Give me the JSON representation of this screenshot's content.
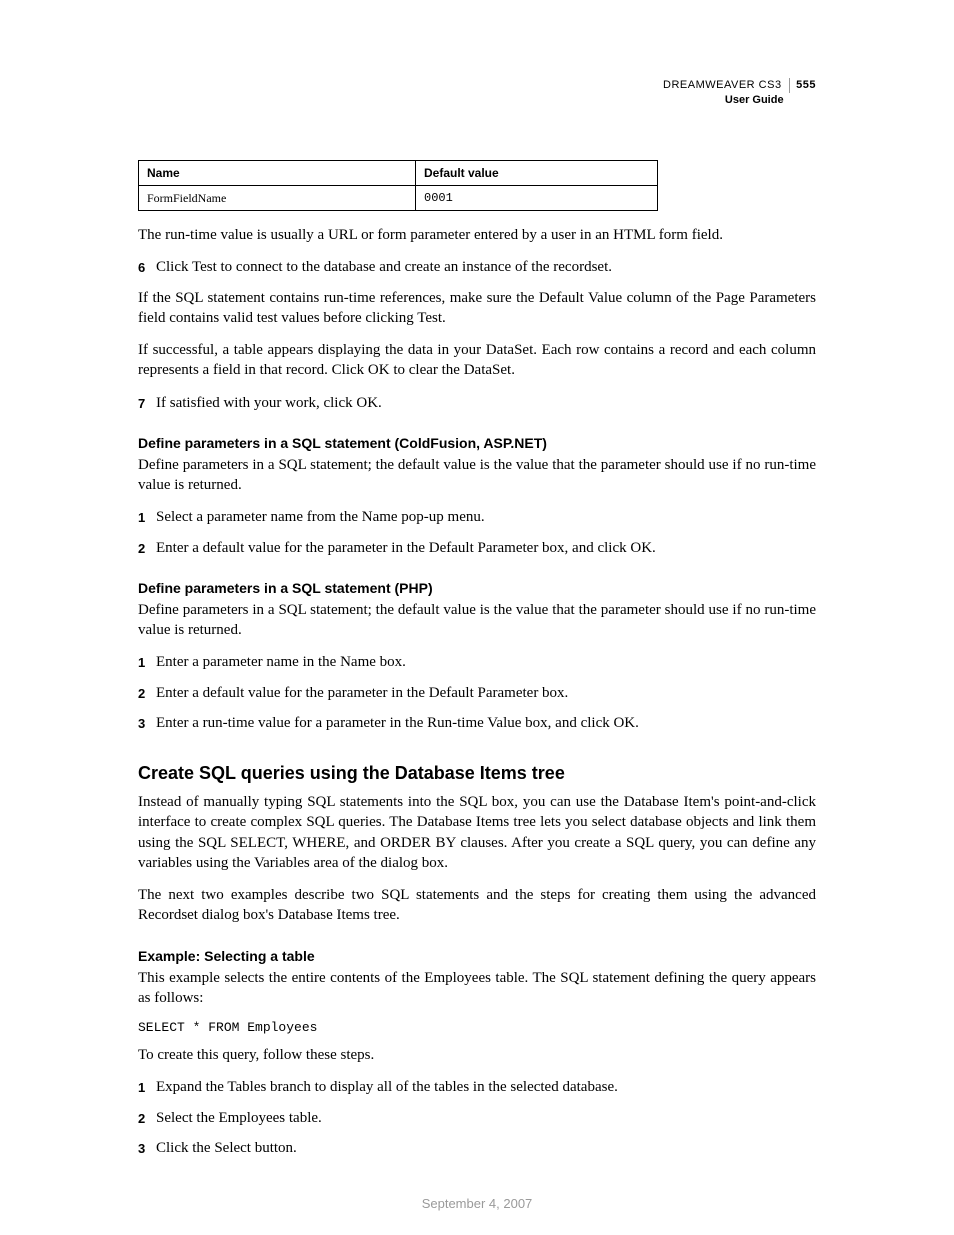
{
  "header": {
    "product": "DREAMWEAVER CS3",
    "guide": "User Guide",
    "page_number": "555"
  },
  "table": {
    "col1": "Name",
    "col2": "Default value",
    "row1_name": "FormFieldName",
    "row1_value": "0001"
  },
  "para": {
    "p1": "The run-time value is usually a URL or form parameter entered by a user in an HTML form field.",
    "p2": "If the SQL statement contains run-time references, make sure the Default Value column of the Page Parameters field contains valid test values before clicking Test.",
    "p3": "If successful, a table appears displaying the data in your DataSet. Each row contains a record and each column represents a field in that record. Click OK to clear the DataSet.",
    "cf_intro": "Define parameters in a SQL statement; the default value is the value that the parameter should use if no run-time value is returned.",
    "php_intro": "Define parameters in a SQL statement; the default value is the value that the parameter should use if no run-time value is returned.",
    "sql_p1": "Instead of manually typing SQL statements into the SQL box, you can use the Database Item's point-and-click interface to create complex SQL queries. The Database Items tree lets you select database objects and link them using the SQL SELECT, WHERE, and ORDER BY clauses. After you create a SQL query, you can define any variables using the Variables area of the dialog box.",
    "sql_p2": "The next two examples describe two SQL statements and the steps for creating them using the advanced Recordset dialog box's Database Items tree.",
    "ex_intro": "This example selects the entire contents of the Employees table. The SQL statement defining the query appears as follows:",
    "ex_followup": "To create this query, follow these steps."
  },
  "steps_main": {
    "s6": "Click Test to connect to the database and create an instance of the recordset.",
    "s7": "If satisfied with your work, click OK."
  },
  "subheads": {
    "cf": "Define parameters in a SQL statement (ColdFusion, ASP.NET)",
    "php": "Define parameters in a SQL statement (PHP)",
    "ex": "Example: Selecting a table"
  },
  "steps_cf": {
    "s1": "Select a parameter name from the Name pop-up menu.",
    "s2": "Enter a default value for the parameter in the Default Parameter box, and click OK."
  },
  "steps_php": {
    "s1": "Enter a parameter name in the Name box.",
    "s2": "Enter a default value for the parameter in the Default Parameter box.",
    "s3": "Enter a run-time value for a parameter in the Run-time Value box, and click OK."
  },
  "section_heading": "Create SQL queries using the Database Items tree",
  "code": "SELECT * FROM Employees",
  "steps_ex": {
    "s1": "Expand the Tables branch to display all of the tables in the selected database.",
    "s2": "Select the Employees table.",
    "s3": "Click the Select button."
  },
  "numbers": {
    "n1": "1",
    "n2": "2",
    "n3": "3",
    "n6": "6",
    "n7": "7"
  },
  "footer_date": "September 4, 2007"
}
